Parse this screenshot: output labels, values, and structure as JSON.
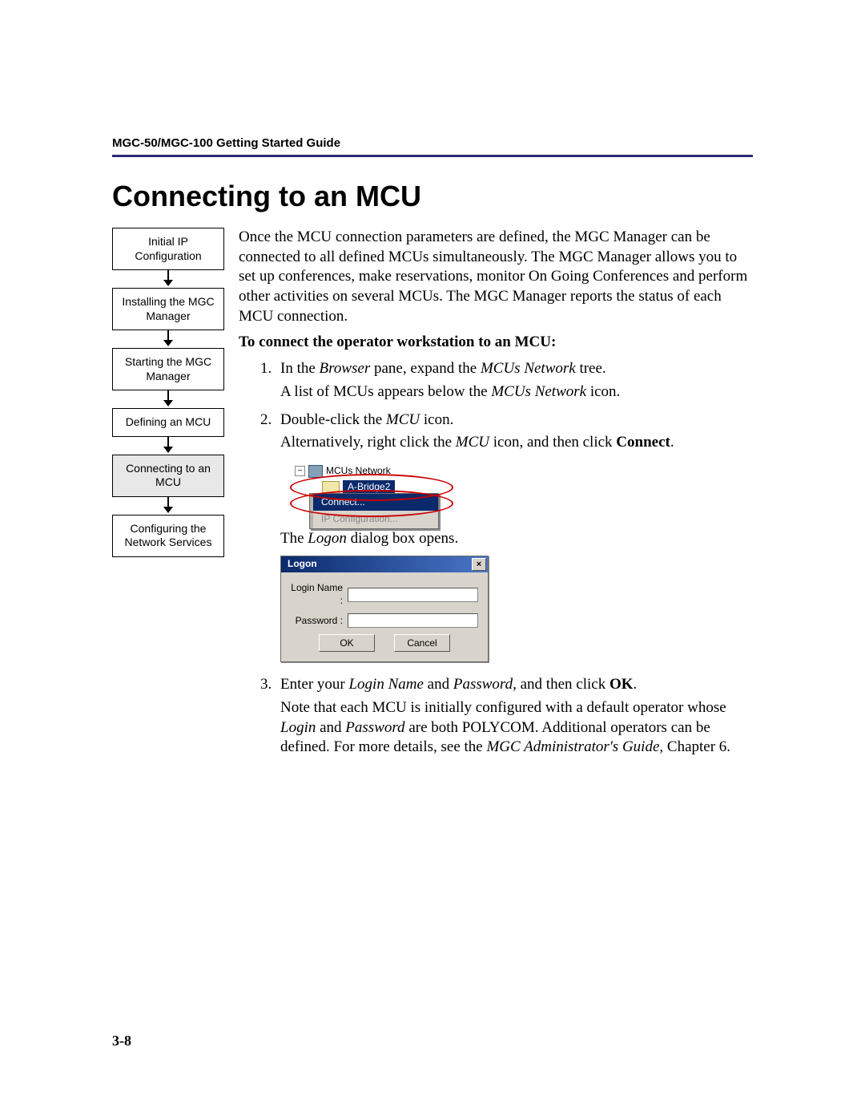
{
  "header": {
    "breadcrumb": "MGC-50/MGC-100 Getting Started Guide"
  },
  "title": "Connecting to an MCU",
  "pagenum": "3-8",
  "flow": {
    "step1": "Initial IP Configuration",
    "step2": "Installing the MGC Manager",
    "step3": "Starting the MGC Manager",
    "step4": "Defining an MCU",
    "step5": "Connecting to an MCU",
    "step6": "Configuring the Network Services"
  },
  "intro": "Once the MCU connection parameters are defined, the MGC Manager can be connected to all defined MCUs simultaneously. The MGC Manager allows you to set up conferences, make reservations, monitor On Going Conferences and perform other activities on several MCUs. The MGC Manager reports the status of each MCU connection.",
  "subhead": "To connect the operator workstation to an MCU:",
  "step1": {
    "pre": "In the ",
    "i1": "Browser",
    "mid1": " pane, expand the ",
    "i2": "MCUs Network",
    "post1": " tree.",
    "line2a": "A list of MCUs appears below the ",
    "line2i": "MCUs Network",
    "line2b": " icon."
  },
  "step2": {
    "pre": "Double-click the ",
    "i1": "MCU",
    "post1": " icon.",
    "alt_pre": "Alternatively, right click the ",
    "alt_i": "MCU",
    "alt_mid": " icon, and then click ",
    "alt_b": "Connect",
    "alt_end": "."
  },
  "logon_line": {
    "pre": "The ",
    "i": "Logon",
    "post": " dialog box opens."
  },
  "step3": {
    "pre": "Enter your ",
    "i1": "Login Name",
    "mid1": " and ",
    "i2": "Password,",
    "mid2": " and then click ",
    "b": "OK",
    "end": ".",
    "note_a": "Note that each MCU is initially configured with a default operator whose ",
    "note_i1": "Login",
    "note_mid1": " and ",
    "note_i2": "Password",
    "note_b": " are both POLYCOM. Additional operators can be defined. For more details, see the ",
    "note_i3": "MGC Administrator's Guide",
    "note_c": ", Chapter 6."
  },
  "tree": {
    "root": "MCUs Network",
    "node": "A-Bridge2",
    "toggle": "−"
  },
  "ctx": {
    "connect": "Connect...",
    "ipconfig": "IP Configuration..."
  },
  "dlg": {
    "title": "Logon",
    "close": "×",
    "login_label": "Login Name :",
    "password_label": "Password :",
    "ok": "OK",
    "cancel": "Cancel"
  }
}
